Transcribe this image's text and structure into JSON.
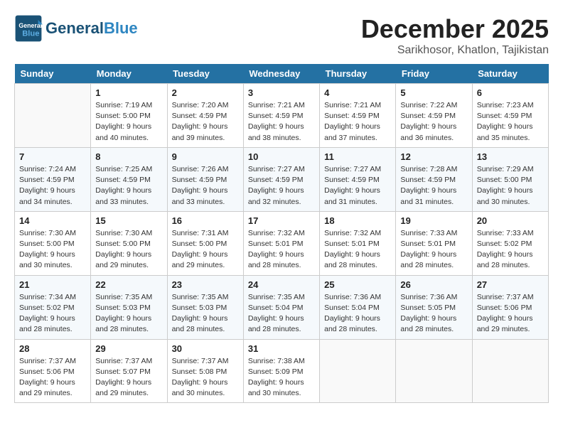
{
  "logo": {
    "general": "General",
    "blue": "Blue"
  },
  "header": {
    "month": "December 2025",
    "location": "Sarikhosor, Khatlon, Tajikistan"
  },
  "weekdays": [
    "Sunday",
    "Monday",
    "Tuesday",
    "Wednesday",
    "Thursday",
    "Friday",
    "Saturday"
  ],
  "weeks": [
    [
      {
        "day": "",
        "sunrise": "",
        "sunset": "",
        "daylight": ""
      },
      {
        "day": "1",
        "sunrise": "Sunrise: 7:19 AM",
        "sunset": "Sunset: 5:00 PM",
        "daylight": "Daylight: 9 hours and 40 minutes."
      },
      {
        "day": "2",
        "sunrise": "Sunrise: 7:20 AM",
        "sunset": "Sunset: 4:59 PM",
        "daylight": "Daylight: 9 hours and 39 minutes."
      },
      {
        "day": "3",
        "sunrise": "Sunrise: 7:21 AM",
        "sunset": "Sunset: 4:59 PM",
        "daylight": "Daylight: 9 hours and 38 minutes."
      },
      {
        "day": "4",
        "sunrise": "Sunrise: 7:21 AM",
        "sunset": "Sunset: 4:59 PM",
        "daylight": "Daylight: 9 hours and 37 minutes."
      },
      {
        "day": "5",
        "sunrise": "Sunrise: 7:22 AM",
        "sunset": "Sunset: 4:59 PM",
        "daylight": "Daylight: 9 hours and 36 minutes."
      },
      {
        "day": "6",
        "sunrise": "Sunrise: 7:23 AM",
        "sunset": "Sunset: 4:59 PM",
        "daylight": "Daylight: 9 hours and 35 minutes."
      }
    ],
    [
      {
        "day": "7",
        "sunrise": "Sunrise: 7:24 AM",
        "sunset": "Sunset: 4:59 PM",
        "daylight": "Daylight: 9 hours and 34 minutes."
      },
      {
        "day": "8",
        "sunrise": "Sunrise: 7:25 AM",
        "sunset": "Sunset: 4:59 PM",
        "daylight": "Daylight: 9 hours and 33 minutes."
      },
      {
        "day": "9",
        "sunrise": "Sunrise: 7:26 AM",
        "sunset": "Sunset: 4:59 PM",
        "daylight": "Daylight: 9 hours and 33 minutes."
      },
      {
        "day": "10",
        "sunrise": "Sunrise: 7:27 AM",
        "sunset": "Sunset: 4:59 PM",
        "daylight": "Daylight: 9 hours and 32 minutes."
      },
      {
        "day": "11",
        "sunrise": "Sunrise: 7:27 AM",
        "sunset": "Sunset: 4:59 PM",
        "daylight": "Daylight: 9 hours and 31 minutes."
      },
      {
        "day": "12",
        "sunrise": "Sunrise: 7:28 AM",
        "sunset": "Sunset: 4:59 PM",
        "daylight": "Daylight: 9 hours and 31 minutes."
      },
      {
        "day": "13",
        "sunrise": "Sunrise: 7:29 AM",
        "sunset": "Sunset: 5:00 PM",
        "daylight": "Daylight: 9 hours and 30 minutes."
      }
    ],
    [
      {
        "day": "14",
        "sunrise": "Sunrise: 7:30 AM",
        "sunset": "Sunset: 5:00 PM",
        "daylight": "Daylight: 9 hours and 30 minutes."
      },
      {
        "day": "15",
        "sunrise": "Sunrise: 7:30 AM",
        "sunset": "Sunset: 5:00 PM",
        "daylight": "Daylight: 9 hours and 29 minutes."
      },
      {
        "day": "16",
        "sunrise": "Sunrise: 7:31 AM",
        "sunset": "Sunset: 5:00 PM",
        "daylight": "Daylight: 9 hours and 29 minutes."
      },
      {
        "day": "17",
        "sunrise": "Sunrise: 7:32 AM",
        "sunset": "Sunset: 5:01 PM",
        "daylight": "Daylight: 9 hours and 28 minutes."
      },
      {
        "day": "18",
        "sunrise": "Sunrise: 7:32 AM",
        "sunset": "Sunset: 5:01 PM",
        "daylight": "Daylight: 9 hours and 28 minutes."
      },
      {
        "day": "19",
        "sunrise": "Sunrise: 7:33 AM",
        "sunset": "Sunset: 5:01 PM",
        "daylight": "Daylight: 9 hours and 28 minutes."
      },
      {
        "day": "20",
        "sunrise": "Sunrise: 7:33 AM",
        "sunset": "Sunset: 5:02 PM",
        "daylight": "Daylight: 9 hours and 28 minutes."
      }
    ],
    [
      {
        "day": "21",
        "sunrise": "Sunrise: 7:34 AM",
        "sunset": "Sunset: 5:02 PM",
        "daylight": "Daylight: 9 hours and 28 minutes."
      },
      {
        "day": "22",
        "sunrise": "Sunrise: 7:35 AM",
        "sunset": "Sunset: 5:03 PM",
        "daylight": "Daylight: 9 hours and 28 minutes."
      },
      {
        "day": "23",
        "sunrise": "Sunrise: 7:35 AM",
        "sunset": "Sunset: 5:03 PM",
        "daylight": "Daylight: 9 hours and 28 minutes."
      },
      {
        "day": "24",
        "sunrise": "Sunrise: 7:35 AM",
        "sunset": "Sunset: 5:04 PM",
        "daylight": "Daylight: 9 hours and 28 minutes."
      },
      {
        "day": "25",
        "sunrise": "Sunrise: 7:36 AM",
        "sunset": "Sunset: 5:04 PM",
        "daylight": "Daylight: 9 hours and 28 minutes."
      },
      {
        "day": "26",
        "sunrise": "Sunrise: 7:36 AM",
        "sunset": "Sunset: 5:05 PM",
        "daylight": "Daylight: 9 hours and 28 minutes."
      },
      {
        "day": "27",
        "sunrise": "Sunrise: 7:37 AM",
        "sunset": "Sunset: 5:06 PM",
        "daylight": "Daylight: 9 hours and 29 minutes."
      }
    ],
    [
      {
        "day": "28",
        "sunrise": "Sunrise: 7:37 AM",
        "sunset": "Sunset: 5:06 PM",
        "daylight": "Daylight: 9 hours and 29 minutes."
      },
      {
        "day": "29",
        "sunrise": "Sunrise: 7:37 AM",
        "sunset": "Sunset: 5:07 PM",
        "daylight": "Daylight: 9 hours and 29 minutes."
      },
      {
        "day": "30",
        "sunrise": "Sunrise: 7:37 AM",
        "sunset": "Sunset: 5:08 PM",
        "daylight": "Daylight: 9 hours and 30 minutes."
      },
      {
        "day": "31",
        "sunrise": "Sunrise: 7:38 AM",
        "sunset": "Sunset: 5:09 PM",
        "daylight": "Daylight: 9 hours and 30 minutes."
      },
      {
        "day": "",
        "sunrise": "",
        "sunset": "",
        "daylight": ""
      },
      {
        "day": "",
        "sunrise": "",
        "sunset": "",
        "daylight": ""
      },
      {
        "day": "",
        "sunrise": "",
        "sunset": "",
        "daylight": ""
      }
    ]
  ]
}
